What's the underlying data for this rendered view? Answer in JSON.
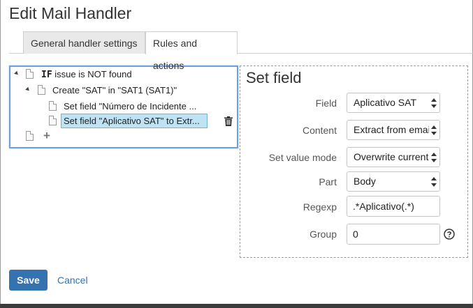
{
  "dialog": {
    "title": "Edit Mail Handler"
  },
  "tabs": [
    {
      "label": "General handler settings",
      "active": false
    },
    {
      "label": "Rules and actions",
      "active": true
    }
  ],
  "tree": {
    "root": {
      "keyword": "IF",
      "label": "issue is NOT found"
    },
    "child": {
      "label": "Create \"SAT\" in \"SAT1 (SAT1)\""
    },
    "actions": [
      {
        "label": "Set field \"Número de Incidente ..."
      },
      {
        "label": "Set field \"Aplicativo SAT\" to Extr...",
        "selected": true
      }
    ],
    "add_icon": "plus-icon",
    "delete_icon": "trash-icon"
  },
  "set_field": {
    "title": "Set field",
    "field_label": "Field",
    "field_value": "Aplicativo SAT",
    "content_label": "Content",
    "content_value": "Extract from email body",
    "mode_label": "Set value mode",
    "mode_value": "Overwrite current value",
    "part_label": "Part",
    "part_value": "Body",
    "regexp_label": "Regexp",
    "regexp_value": ".*Aplicativo(.*)",
    "group_label": "Group",
    "group_value": "0",
    "help_icon": "question-circle-icon"
  },
  "footer": {
    "save_label": "Save",
    "cancel_label": "Cancel"
  },
  "colors": {
    "accent": "#3572b0",
    "selection": "#bfe3f2",
    "tree_border": "#6f9fe0"
  }
}
